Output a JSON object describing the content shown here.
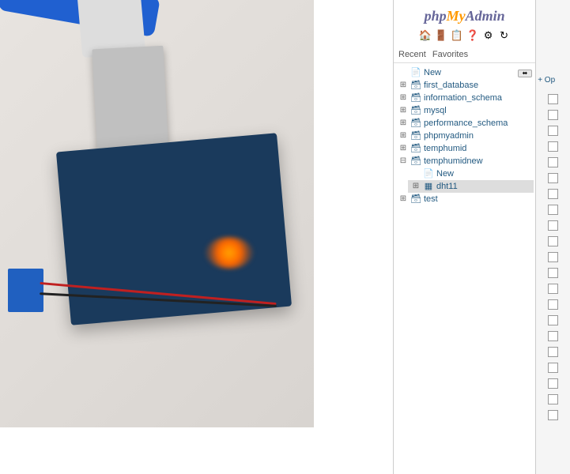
{
  "logo": {
    "php": "php",
    "my": "My",
    "admin": "Admin"
  },
  "tabs": {
    "recent": "Recent",
    "favorites": "Favorites"
  },
  "toolbar_icons": [
    "home-icon",
    "logout-icon",
    "query-icon",
    "docs-icon",
    "settings-icon",
    "reload-icon"
  ],
  "tree": {
    "new": "New",
    "databases": [
      {
        "name": "first_database",
        "expanded": false
      },
      {
        "name": "information_schema",
        "expanded": false
      },
      {
        "name": "mysql",
        "expanded": false
      },
      {
        "name": "performance_schema",
        "expanded": false
      },
      {
        "name": "phpmyadmin",
        "expanded": false
      },
      {
        "name": "temphumid",
        "expanded": false
      },
      {
        "name": "temphumidnew",
        "expanded": true,
        "new": "New",
        "tables": [
          {
            "name": "dht11",
            "selected": true
          }
        ]
      },
      {
        "name": "test",
        "expanded": false
      }
    ]
  },
  "options_link": "+ Op",
  "glyphs": {
    "plus": "⊞",
    "minus": "⊟",
    "db": "🗃",
    "new": "📄",
    "table": "▦",
    "home": "🏠",
    "logout": "🚪",
    "sql": "📋",
    "docs": "❓",
    "cog": "⚙",
    "reload": "↻"
  }
}
